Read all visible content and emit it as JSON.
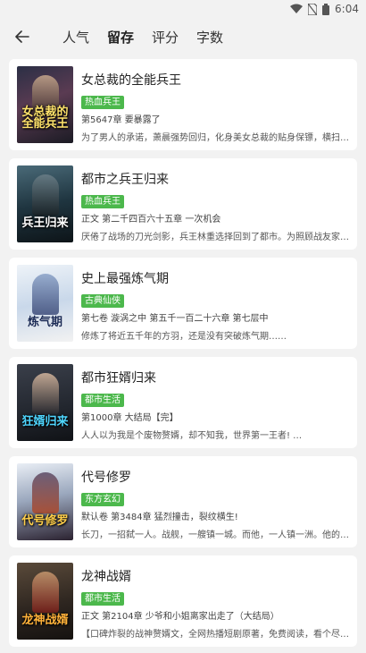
{
  "status": {
    "time": "6:04"
  },
  "nav": {
    "back_icon": "arrow-left-icon",
    "tabs": [
      {
        "label": "人气"
      },
      {
        "label": "留存"
      },
      {
        "label": "评分"
      },
      {
        "label": "字数"
      }
    ],
    "active_tab": "留存"
  },
  "colors": {
    "tag": "#4cb84c",
    "background": "#f2f2f2",
    "card": "#ffffff"
  },
  "books": [
    {
      "title": "女总裁的全能兵王",
      "tag": "热血兵王",
      "chapter": "第5647章 要暴露了",
      "desc": "为了男人的承诺，萧晨强势回归，化身美女总裁的贴身保镖，横扫八方之…",
      "cover_text": "女总裁的全能兵王"
    },
    {
      "title": "都市之兵王归来",
      "tag": "热血兵王",
      "chapter": "正文 第二千四百六十五章 一次机会",
      "desc": "厌倦了战场的刀光剑影，兵王林重选择回到了都市。为照顾战友家人，他…",
      "cover_text": "兵王归来"
    },
    {
      "title": "史上最强炼气期",
      "tag": "古典仙侠",
      "chapter": "第七卷 漩涡之中 第五千一百二十六章 第七层中",
      "desc": "修炼了将近五千年的方羽，还是没有突破炼气期……",
      "cover_text": "炼气期"
    },
    {
      "title": "都市狂婿归来",
      "tag": "都市生活",
      "chapter": "第1000章 大结局【完】",
      "desc": "人人以为我是个废物赘婿，却不知我，世界第一王者! …",
      "cover_text": "狂婿归来"
    },
    {
      "title": "代号修罗",
      "tag": "东方玄幻",
      "chapter": "默认卷 第3484章 猛烈撞击，裂纹横生!",
      "desc": "长刀，一招弑一人。战舰，一艘镇一城。而他，一人镇一洲。他的封号，…",
      "cover_text": "代号修罗"
    },
    {
      "title": "龙神战婿",
      "tag": "都市生活",
      "chapter": "正文 第2104章 少爷和小姐离家出走了（大结局）",
      "desc": "【口碑炸裂的战神赘婿文，全网热播短剧原著，免费阅读，看个尽兴】…",
      "cover_text": "龙神战婿"
    }
  ]
}
